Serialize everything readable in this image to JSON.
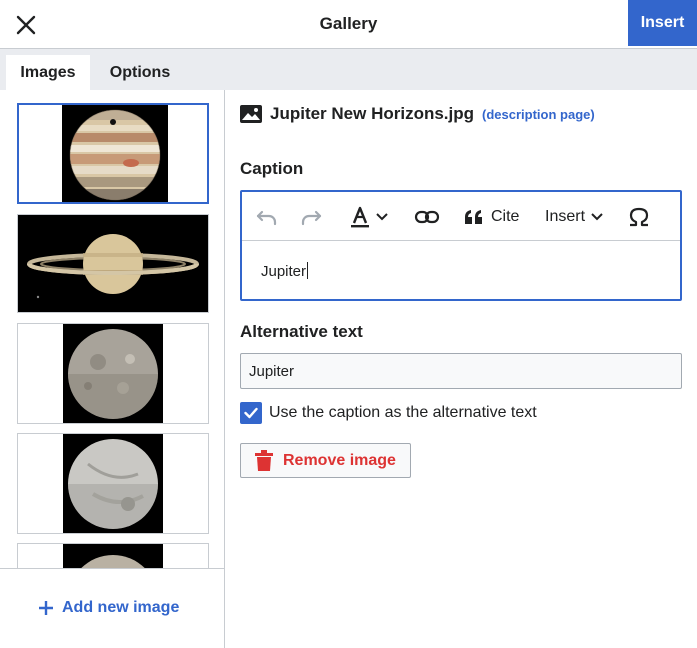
{
  "header": {
    "title": "Gallery",
    "insert_label": "Insert",
    "close_icon": "close-icon"
  },
  "tabs": [
    {
      "label": "Images",
      "active": true
    },
    {
      "label": "Options",
      "active": false
    }
  ],
  "thumbnails": [
    {
      "subject": "Jupiter",
      "selected": true
    },
    {
      "subject": "Saturn",
      "selected": false
    },
    {
      "subject": "Ariel",
      "selected": false
    },
    {
      "subject": "Miranda",
      "selected": false
    },
    {
      "subject": "moon",
      "selected": false
    }
  ],
  "left_footer": {
    "add_new_label": "Add new image"
  },
  "details": {
    "file_name": "Jupiter New Horizons.jpg",
    "description_link": "(description page)",
    "caption_heading": "Caption",
    "caption_value": "Jupiter",
    "toolbar": {
      "cite_label": "Cite",
      "insert_label": "Insert"
    },
    "alt_heading": "Alternative text",
    "alt_value": "Jupiter",
    "checkbox_label": "Use the caption as the alternative text",
    "checkbox_checked": true,
    "remove_label": "Remove image"
  },
  "colors": {
    "accent": "#3366cc",
    "destructive": "#dd3333",
    "border": "#c8ccd1",
    "tab_bar": "#eaecf0"
  }
}
